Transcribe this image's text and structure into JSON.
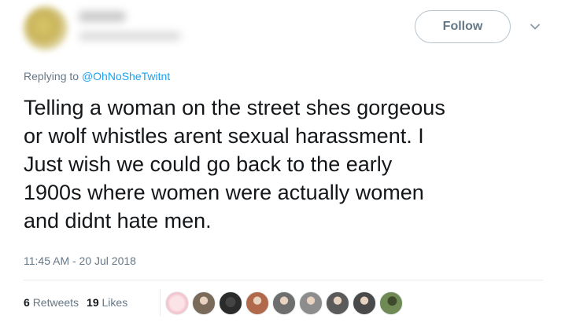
{
  "header": {
    "follow_label": "Follow"
  },
  "reply": {
    "prefix": "Replying to",
    "mention": "@OhNoSheTwitnt"
  },
  "tweet": {
    "text": "Telling a woman on the street shes gorgeous\nor wolf whistles arent sexual harassment. I\nJust wish we could go back to the early\n1900s where women were actually women\nand didnt hate men.",
    "timestamp": "11:45 AM - 20 Jul 2018"
  },
  "stats": {
    "retweets_count": "6",
    "retweets_label": "Retweets",
    "likes_count": "19",
    "likes_label": "Likes"
  },
  "likers": [
    {
      "icon": "pink-sticker-avatar",
      "color": "#f4c6cf"
    },
    {
      "icon": "person-avatar",
      "color": "#7a6a5a"
    },
    {
      "icon": "dark-avatar",
      "color": "#2b2b2b"
    },
    {
      "icon": "person-avatar",
      "color": "#b0694a"
    },
    {
      "icon": "person-avatar",
      "color": "#6e6e6e"
    },
    {
      "icon": "person-avatar",
      "color": "#8d8d8d"
    },
    {
      "icon": "person-avatar",
      "color": "#5b5b5b"
    },
    {
      "icon": "person-avatar",
      "color": "#4a4a4a"
    },
    {
      "icon": "outdoor-avatar",
      "color": "#6f8a55"
    }
  ]
}
